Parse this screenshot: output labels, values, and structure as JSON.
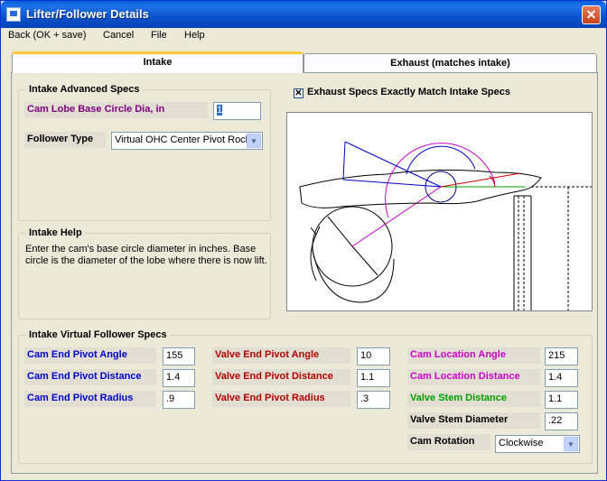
{
  "window": {
    "title": "Lifter/Follower Details",
    "close_glyph": "✕"
  },
  "menu": {
    "items": [
      "Back (OK + save)",
      "Cancel",
      "File",
      "Help"
    ]
  },
  "tabs": [
    "Intake",
    "Exhaust (matches intake)"
  ],
  "advanced": {
    "group_label": "Intake Advanced Specs",
    "base_circle_label": "Cam Lobe Base Circle Dia, in",
    "base_circle_value": "1",
    "follower_type_label": "Follower Type",
    "follower_type_value": "Virtual OHC Center Pivot Rock"
  },
  "match_checkbox": {
    "label": "Exhaust Specs Exactly Match Intake Specs",
    "checked_glyph": "✕"
  },
  "help": {
    "group_label": "Intake Help",
    "text": "Enter the cam's base circle diameter in inches.  Base circle is the diameter of the lobe where there is now lift."
  },
  "virtual": {
    "group_label": "Intake Virtual Follower Specs",
    "cam_end_pivot_angle_label": "Cam End Pivot Angle",
    "cam_end_pivot_angle_value": "155",
    "cam_end_pivot_distance_label": "Cam End Pivot Distance",
    "cam_end_pivot_distance_value": "1.4",
    "cam_end_pivot_radius_label": "Cam End Pivot Radius",
    "cam_end_pivot_radius_value": ".9",
    "valve_end_pivot_angle_label": "Valve End Pivot Angle",
    "valve_end_pivot_angle_value": "10",
    "valve_end_pivot_distance_label": "Valve End Pivot Distance",
    "valve_end_pivot_distance_value": "1.1",
    "valve_end_pivot_radius_label": "Valve End Pivot Radius",
    "valve_end_pivot_radius_value": ".3",
    "cam_location_angle_label": "Cam Location Angle",
    "cam_location_angle_value": "215",
    "cam_location_distance_label": "Cam Location Distance",
    "cam_location_distance_value": "1.4",
    "valve_stem_distance_label": "Valve Stem Distance",
    "valve_stem_distance_value": "1.1",
    "valve_stem_diameter_label": "Valve Stem Diameter",
    "valve_stem_diameter_value": ".22",
    "cam_rotation_label": "Cam Rotation",
    "cam_rotation_value": "Clockwise"
  },
  "colors": {
    "blue_label": "#0000cc",
    "red_label": "#b00000",
    "magenta_label": "#cc00cc",
    "green_label": "#00a000",
    "purple_label": "#800080"
  }
}
